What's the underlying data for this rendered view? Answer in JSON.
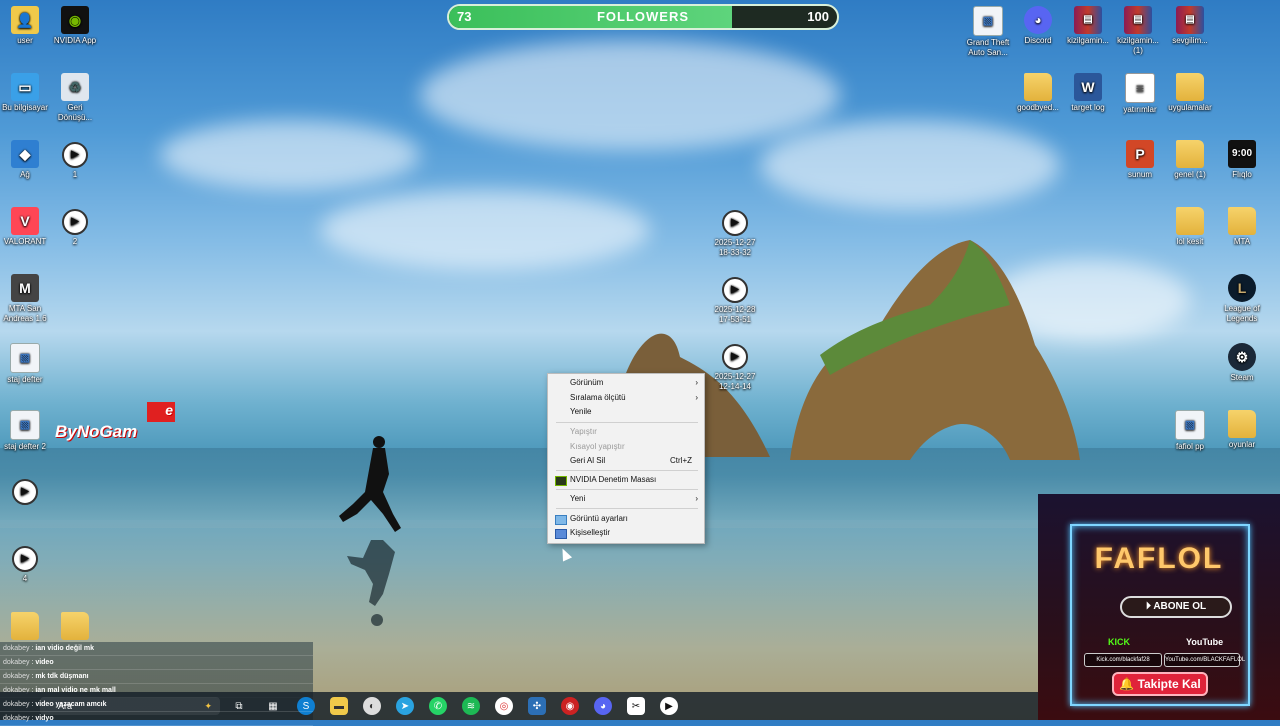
{
  "followers": {
    "current": "73",
    "label": "FOLLOWERS",
    "goal": "100",
    "fraction": 0.73
  },
  "desktop": {
    "left_icons": [
      {
        "label": "user",
        "icon": "user-folder-icon"
      },
      {
        "label": "NVIDIA App",
        "icon": "nvidia-icon"
      },
      {
        "label": "Bu bilgisayar",
        "icon": "computer-icon"
      },
      {
        "label": "Geri Dönüşü...",
        "icon": "recycle-bin-icon"
      },
      {
        "label": "Ağ",
        "icon": "network-icon"
      },
      {
        "label": "1",
        "icon": "video-file-icon"
      },
      {
        "label": "VALORANT",
        "icon": "valorant-icon"
      },
      {
        "label": "2",
        "icon": "video-file-icon"
      },
      {
        "label": "MTA San Andreas 1.6",
        "icon": "mta-icon"
      },
      {
        "label": "staj defter",
        "icon": "image-file-icon"
      },
      {
        "label": "staj defter 2",
        "icon": "image-file-icon"
      },
      {
        "label": "",
        "icon": "video-file-icon"
      },
      {
        "label": "4",
        "icon": "video-file-icon"
      }
    ],
    "middle_icons": [
      {
        "label": "2025-12-27 18-33-32",
        "icon": "video-file-icon"
      },
      {
        "label": "2025-12-28 17-53-51",
        "icon": "video-file-icon"
      },
      {
        "label": "2025-12-27 12-14-14",
        "icon": "video-file-icon"
      }
    ],
    "right_icons": [
      {
        "label": "Grand Theft Auto San...",
        "icon": "image-file-icon"
      },
      {
        "label": "Discord",
        "icon": "discord-icon"
      },
      {
        "label": "kizilgamin...",
        "icon": "rar-icon"
      },
      {
        "label": "kizilgamin... (1)",
        "icon": "rar-icon"
      },
      {
        "label": "sevgilim...",
        "icon": "rar-icon"
      },
      {
        "label": "goodbyed...",
        "icon": "folder-icon"
      },
      {
        "label": "target log",
        "icon": "word-icon"
      },
      {
        "label": "yatırımlar",
        "icon": "text-file-icon"
      },
      {
        "label": "uygulamalar",
        "icon": "folder-icon"
      },
      {
        "label": "sunum",
        "icon": "powerpoint-icon"
      },
      {
        "label": "genel (1)",
        "icon": "folder-icon"
      },
      {
        "label": "Flıqlo",
        "icon": "clock-icon"
      },
      {
        "label": "lol kesit",
        "icon": "folder-icon"
      },
      {
        "label": "MTA",
        "icon": "folder-icon"
      },
      {
        "label": "League of Legends",
        "icon": "lol-icon"
      },
      {
        "label": "Steam",
        "icon": "steam-icon"
      },
      {
        "label": "fafiol pp",
        "icon": "image-file-icon"
      },
      {
        "label": "oyunlar",
        "icon": "folder-icon"
      }
    ]
  },
  "context_menu": {
    "items": [
      {
        "label": "Görünüm",
        "submenu": true
      },
      {
        "label": "Sıralama ölçütü",
        "submenu": true
      },
      {
        "label": "Yenile"
      },
      {
        "label": "Yapıştır",
        "disabled": true
      },
      {
        "label": "Kısayol yapıştır",
        "disabled": true
      },
      {
        "label": "Geri Al Sil",
        "shortcut": "Ctrl+Z"
      },
      {
        "label": "NVIDIA Denetim Masası",
        "icon": "nvidia-icon"
      },
      {
        "label": "Yeni",
        "submenu": true
      },
      {
        "label": "Görüntü ayarları",
        "icon": "display-icon"
      },
      {
        "label": "Kişiselleştir",
        "icon": "personalize-icon"
      }
    ]
  },
  "watermark": {
    "text": "ByNoGam",
    "e": "e"
  },
  "chat": {
    "messages": [
      {
        "user": "dokabey",
        "text": "ian vidio değil mk"
      },
      {
        "user": "dokabey",
        "text": "video"
      },
      {
        "user": "dokabey",
        "text": "mk tdk düşmanı"
      },
      {
        "user": "dokabey",
        "text": "ian mal vidio ne mk mall"
      },
      {
        "user": "dokabey",
        "text": "video yazacam amcık"
      },
      {
        "user": "dokabey",
        "text": "vidyo"
      }
    ]
  },
  "taskbar": {
    "search_label": "Ara"
  },
  "stream_panel": {
    "title": "FAFLOL",
    "subscribe": "ABONE OL",
    "kick": "KICK",
    "youtube": "YouTube",
    "kick_link": "Kick.com/blackfaf28",
    "youtube_link": "YouTube.com/BLACKFAFLOL",
    "follow": "Takipte Kal"
  },
  "colors": {
    "followers_fill": "#3bbf5a",
    "panel_accent": "#7fd6ff",
    "follow_button": "#e0233a"
  }
}
